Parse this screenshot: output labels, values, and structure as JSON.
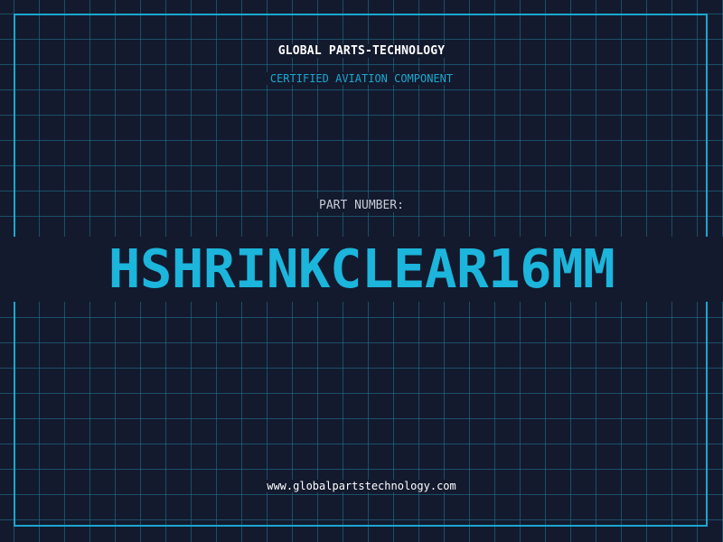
{
  "header": {
    "brand": "GLOBAL PARTS-TECHNOLOGY",
    "subtitle": "CERTIFIED AVIATION COMPONENT"
  },
  "main": {
    "label": "PART NUMBER:",
    "part_number": "HSHRINKCLEAR16MM"
  },
  "footer": {
    "website": "www.globalpartstechnology.com"
  },
  "colors": {
    "background": "#131a2e",
    "grid": "#20788f",
    "accent": "#1aa7cf",
    "text": "#ffffff",
    "label": "#c7ccd6"
  }
}
